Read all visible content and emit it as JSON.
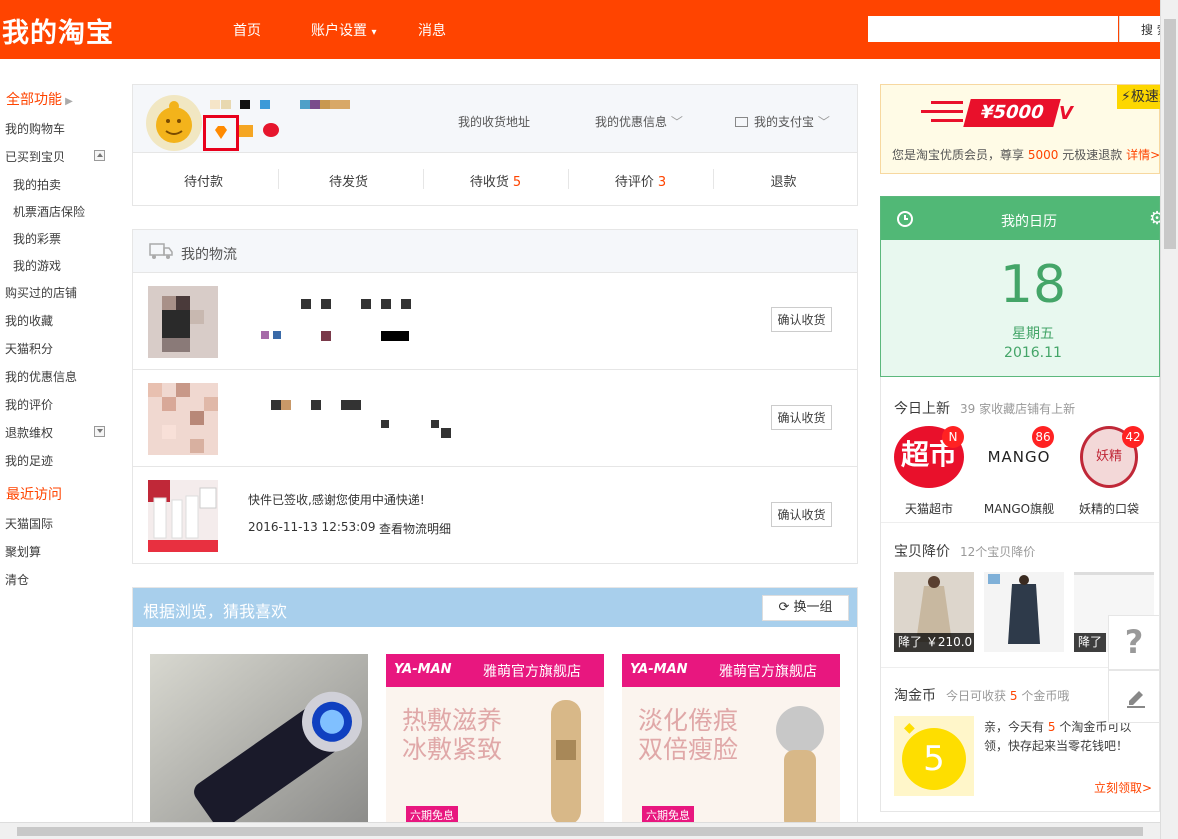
{
  "app": {
    "logo": "我的淘宝"
  },
  "nav": {
    "home": "首页",
    "account": "账户设置",
    "account_arrow": "▾",
    "messages": "消息"
  },
  "search": {
    "button": "搜 索",
    "placeholder": ""
  },
  "sidebar": {
    "all_functions": "全部功能",
    "cart": "我的购物车",
    "bought": "已买到宝贝",
    "auction": "我的拍卖",
    "tickets": "机票酒店保险",
    "lottery": "我的彩票",
    "games": "我的游戏",
    "shops": "购买过的店铺",
    "favorites": "我的收藏",
    "tmall_points": "天猫积分",
    "coupons": "我的优惠信息",
    "reviews": "我的评价",
    "refund": "退款维权",
    "footprint": "我的足迹",
    "recent": "最近访问",
    "tmall_intl": "天猫国际",
    "juhuasuan": "聚划算",
    "clearance": "清仓"
  },
  "profile": {
    "address": "我的收货地址",
    "discount": "我的优惠信息",
    "alipay": "我的支付宝",
    "orders": [
      {
        "label": "待付款",
        "count": ""
      },
      {
        "label": "待发货",
        "count": ""
      },
      {
        "label": "待收货",
        "count": "5"
      },
      {
        "label": "待评价",
        "count": "3"
      },
      {
        "label": "退款",
        "count": ""
      }
    ]
  },
  "logistics": {
    "title": "我的物流",
    "confirm": "确认收货",
    "item3_status": "快件已签收,感谢您使用中通快递!",
    "item3_time": "2016-11-13 12:53:09",
    "item3_detail": "查看物流明细"
  },
  "guess": {
    "title": "根据浏览，猜我喜欢",
    "refresh": "换一组",
    "brand": "YA-MAN",
    "store": "雅萌官方旗舰店",
    "slogan1": "热敷滋养冰敷紧致",
    "slogan2": "淡化倦痕双倍瘦脸",
    "installment": "六期免息"
  },
  "refund_card": {
    "amount": "¥5000",
    "tag": "极速退款",
    "note_pre": "您是淘宝优质会员，尊享",
    "note_amount": "5000",
    "note_post": "元极速退款",
    "detail": "详情>"
  },
  "calendar": {
    "title": "我的日历",
    "day": "18",
    "weekday": "星期五",
    "year_month": "2016.11"
  },
  "new_arrivals": {
    "title": "今日上新",
    "sub": "39 家收藏店铺有上新",
    "shops": [
      {
        "name": "天猫超市",
        "badge": "N",
        "logo_text": "超市"
      },
      {
        "name": "MANGO旗舰",
        "badge": "86",
        "logo_text": "MANGO"
      },
      {
        "name": "妖精的口袋",
        "badge": "42",
        "logo_text": "妖精"
      }
    ]
  },
  "price_drop": {
    "title": "宝贝降价",
    "sub": "12个宝贝降价",
    "tag1": "降了 ￥210.0",
    "tag3": "降了"
  },
  "coins": {
    "title": "淘金币",
    "sub_pre": "今日可收获",
    "sub_num": "5",
    "sub_post": "个金币哦",
    "count": "5",
    "msg_pre": "亲，今天有",
    "msg_num": "5",
    "msg_post": "个淘金币可以领，快存起来当零花钱吧！",
    "link": "立刻领取>"
  },
  "float": {
    "help": "?"
  },
  "colors": {
    "brand": "#ff4400",
    "calendar": "#51b876",
    "accent": "#f40"
  }
}
